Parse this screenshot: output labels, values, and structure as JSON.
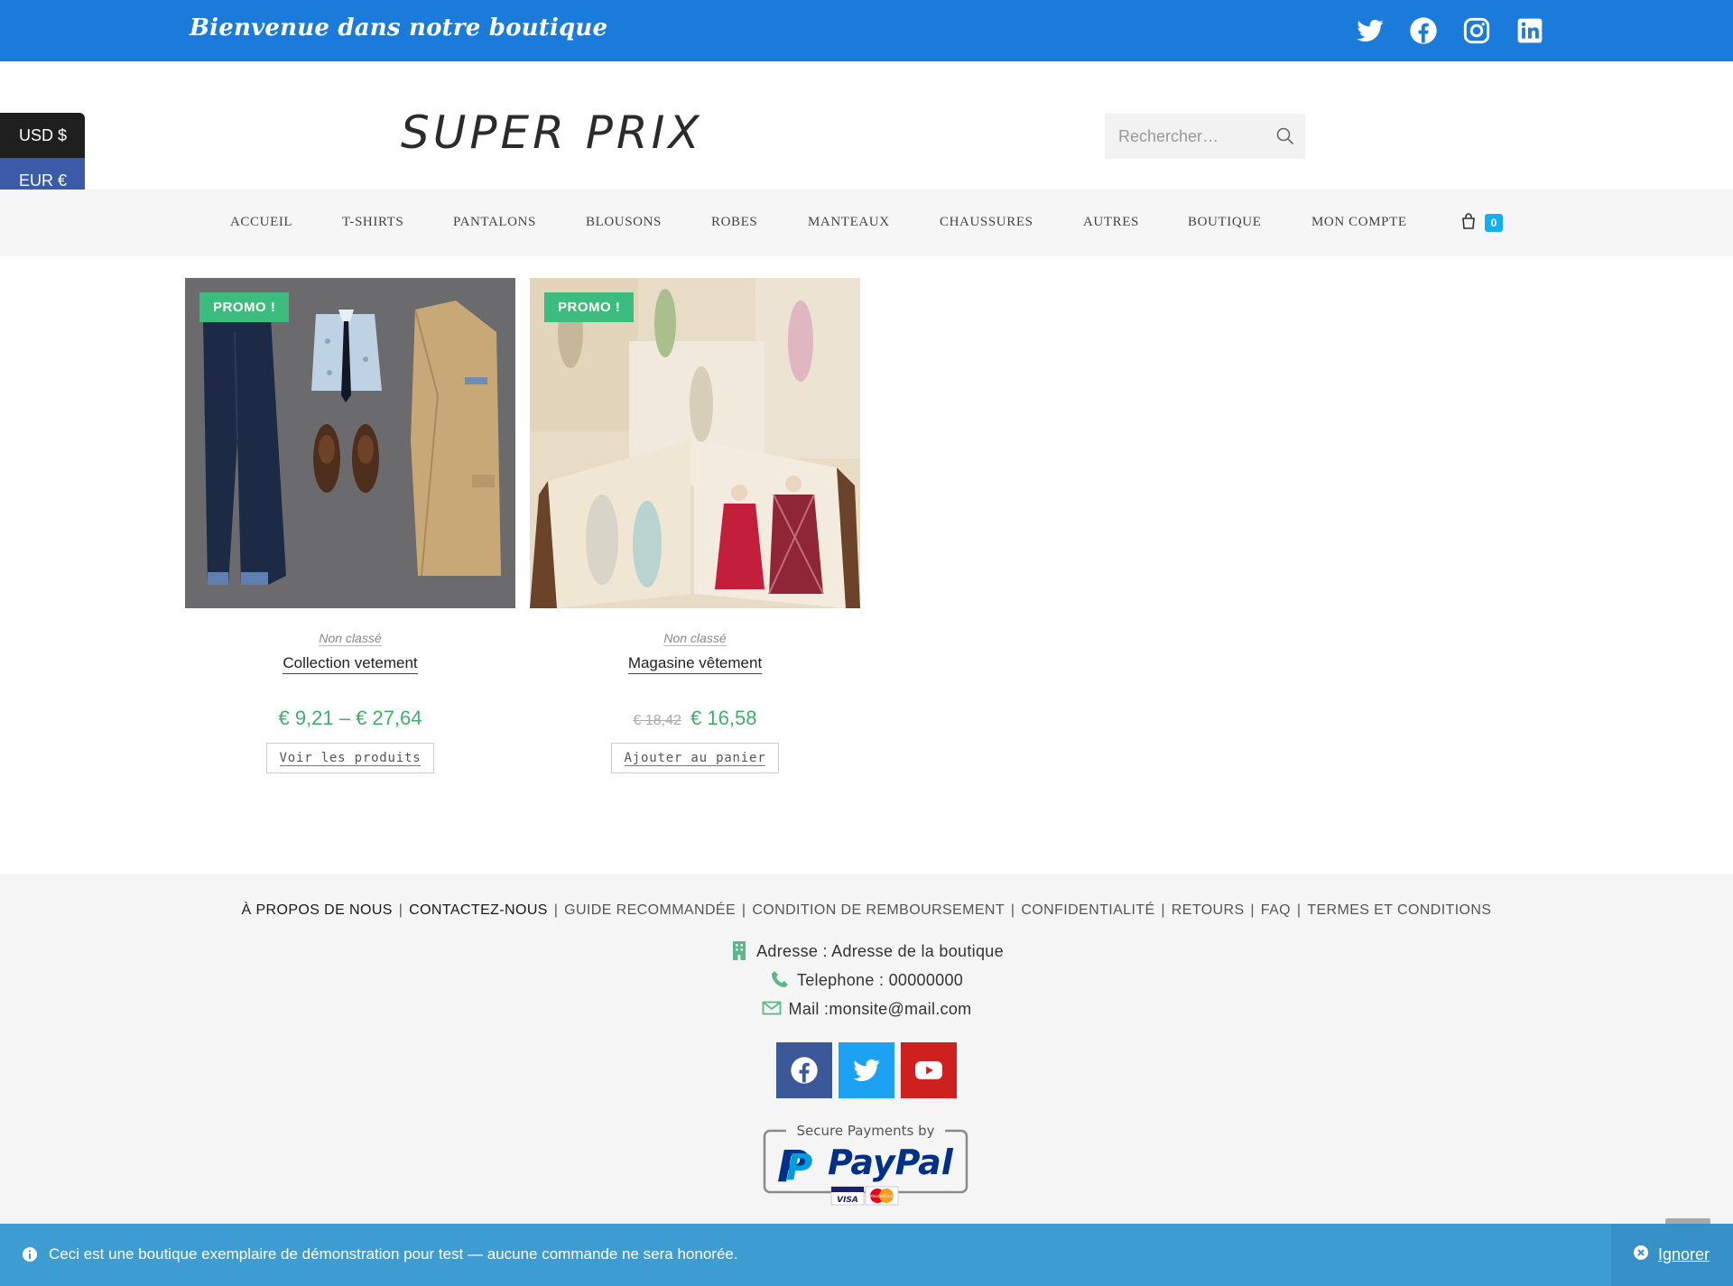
{
  "topbar": {
    "welcome": "Bienvenue dans notre boutique",
    "socials": [
      "twitter-icon",
      "facebook-icon",
      "instagram-icon",
      "linkedin-icon"
    ],
    "bg_color": "#1a7bdb"
  },
  "currency": {
    "usd": "USD $",
    "eur": "EUR €"
  },
  "header": {
    "logo": "SUPER PRIX",
    "search_placeholder": "Rechercher…"
  },
  "nav": {
    "items": [
      "ACCUEIL",
      "T-SHIRTS",
      "PANTALONS",
      "BLOUSONS",
      "ROBES",
      "MANTEAUX",
      "CHAUSSURES",
      "AUTRES",
      "BOUTIQUE",
      "MON COMPTE"
    ],
    "cart_count": "0"
  },
  "products": [
    {
      "badge": "PROMO !",
      "category": "Non classé",
      "title": "Collection vetement",
      "price_old": "",
      "price": "€ 9,21 – € 27,64",
      "button": "Voir les produits"
    },
    {
      "badge": "PROMO !",
      "category": "Non classé",
      "title": "Magasine vêtement",
      "price_old": "€ 18,42",
      "price": "€ 16,58",
      "button": "Ajouter au panier"
    }
  ],
  "footer": {
    "links": {
      "about": "À PROPOS DE NOUS",
      "contact": "CONTACTEZ-NOUS",
      "guide": "GUIDE RECOMMANDÉE",
      "refund": "CONDITION DE REMBOURSEMENT",
      "privacy": "CONFIDENTIALITÉ",
      "returns": "RETOURS",
      "faq": "FAQ",
      "terms": "TERMES ET CONDITIONS"
    },
    "address": "Adresse : Adresse de la boutique",
    "phone": "Telephone : 00000000",
    "mail": "Mail :monsite@mail.com",
    "socials": [
      "facebook-icon",
      "twitter-icon",
      "youtube-icon"
    ],
    "paypal": {
      "heading": "Secure Payments by",
      "brand": "PayPal",
      "cards": [
        "VISA",
        "MasterCard"
      ]
    }
  },
  "notice": {
    "message": "Ceci est une boutique exemplaire de démonstration pour test — aucune commande ne sera honorée.",
    "dismiss": "Ignorer"
  }
}
